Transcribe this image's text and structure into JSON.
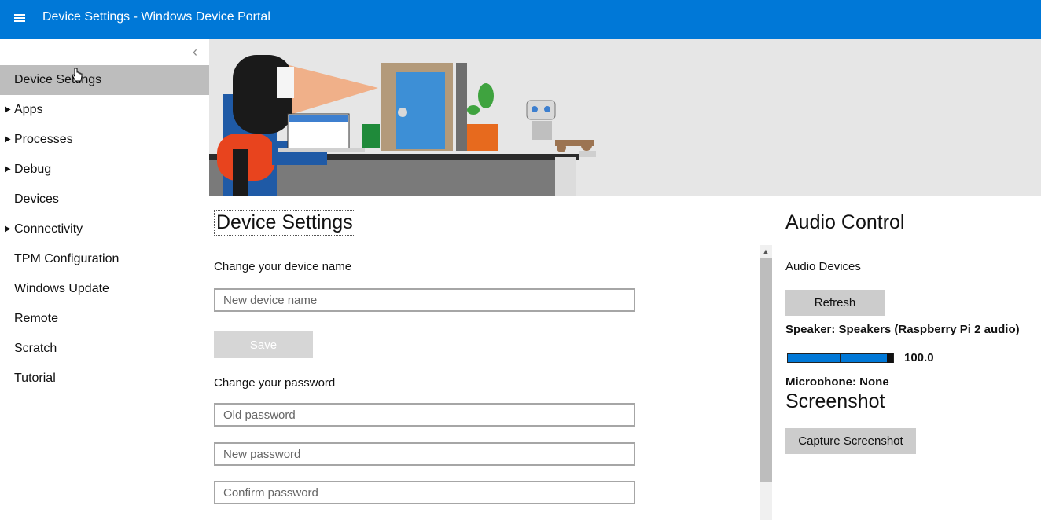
{
  "app": {
    "title": "Device Settings - Windows Device Portal"
  },
  "sidebar": {
    "items": [
      {
        "label": "Device Settings",
        "expandable": false,
        "active": true
      },
      {
        "label": "Apps",
        "expandable": true
      },
      {
        "label": "Processes",
        "expandable": true
      },
      {
        "label": "Debug",
        "expandable": true
      },
      {
        "label": "Devices",
        "expandable": false
      },
      {
        "label": "Connectivity",
        "expandable": true
      },
      {
        "label": "TPM Configuration",
        "expandable": false
      },
      {
        "label": "Windows Update",
        "expandable": false
      },
      {
        "label": "Remote",
        "expandable": false
      },
      {
        "label": "Scratch",
        "expandable": false
      },
      {
        "label": "Tutorial",
        "expandable": false
      }
    ]
  },
  "device_settings": {
    "title": "Device Settings",
    "name_label": "Change your device name",
    "name_placeholder": "New device name",
    "save_label": "Save",
    "password_label": "Change your password",
    "old_password_placeholder": "Old password",
    "new_password_placeholder": "New password",
    "confirm_password_placeholder": "Confirm password"
  },
  "audio": {
    "title": "Audio Control",
    "devices_label": "Audio Devices",
    "refresh_label": "Refresh",
    "speaker_label": "Speaker: Speakers (Raspberry Pi 2 audio)",
    "volume_value": "100.0",
    "volume_level": 100,
    "microphone_label": "Microphone: None"
  },
  "screenshot": {
    "title": "Screenshot",
    "capture_label": "Capture Screenshot"
  },
  "colors": {
    "accent": "#0078d7",
    "active_nav": "#bdbdbd",
    "button": "#cccccc"
  }
}
